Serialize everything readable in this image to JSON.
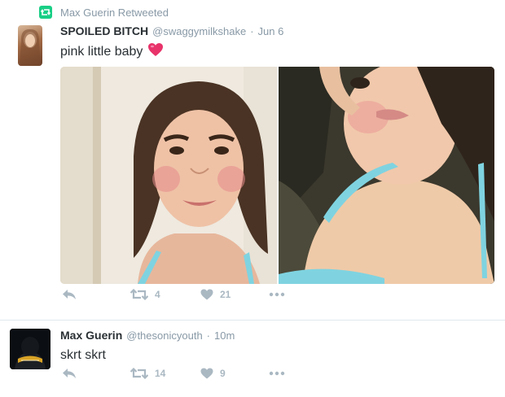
{
  "retweet_context": {
    "text": "Max Guerin Retweeted",
    "icon": "retweet-icon",
    "color": "#19cf86"
  },
  "tweets": [
    {
      "display_name": "SPOILED BITCH",
      "handle": "@swaggymilkshake",
      "separator": "·",
      "time": "Jun 6",
      "text": "pink little baby",
      "emoji": "pink-heart-emoji",
      "media": [
        {
          "description": "photo",
          "icon": "photo"
        },
        {
          "description": "photo",
          "icon": "photo"
        }
      ],
      "actions": {
        "reply_icon": "reply-icon",
        "retweet_count": "4",
        "like_count": "21",
        "more_icon": "more-icon"
      }
    },
    {
      "display_name": "Max Guerin",
      "handle": "@thesonicyouth",
      "separator": "·",
      "time": "10m",
      "text": "skrt skrt",
      "actions": {
        "reply_icon": "reply-icon",
        "retweet_count": "14",
        "like_count": "9",
        "more_icon": "more-icon"
      }
    }
  ],
  "colors": {
    "name": "#292f33",
    "meta": "#8899a6",
    "icons": "#aab8c2",
    "heart": "#e0245e"
  }
}
